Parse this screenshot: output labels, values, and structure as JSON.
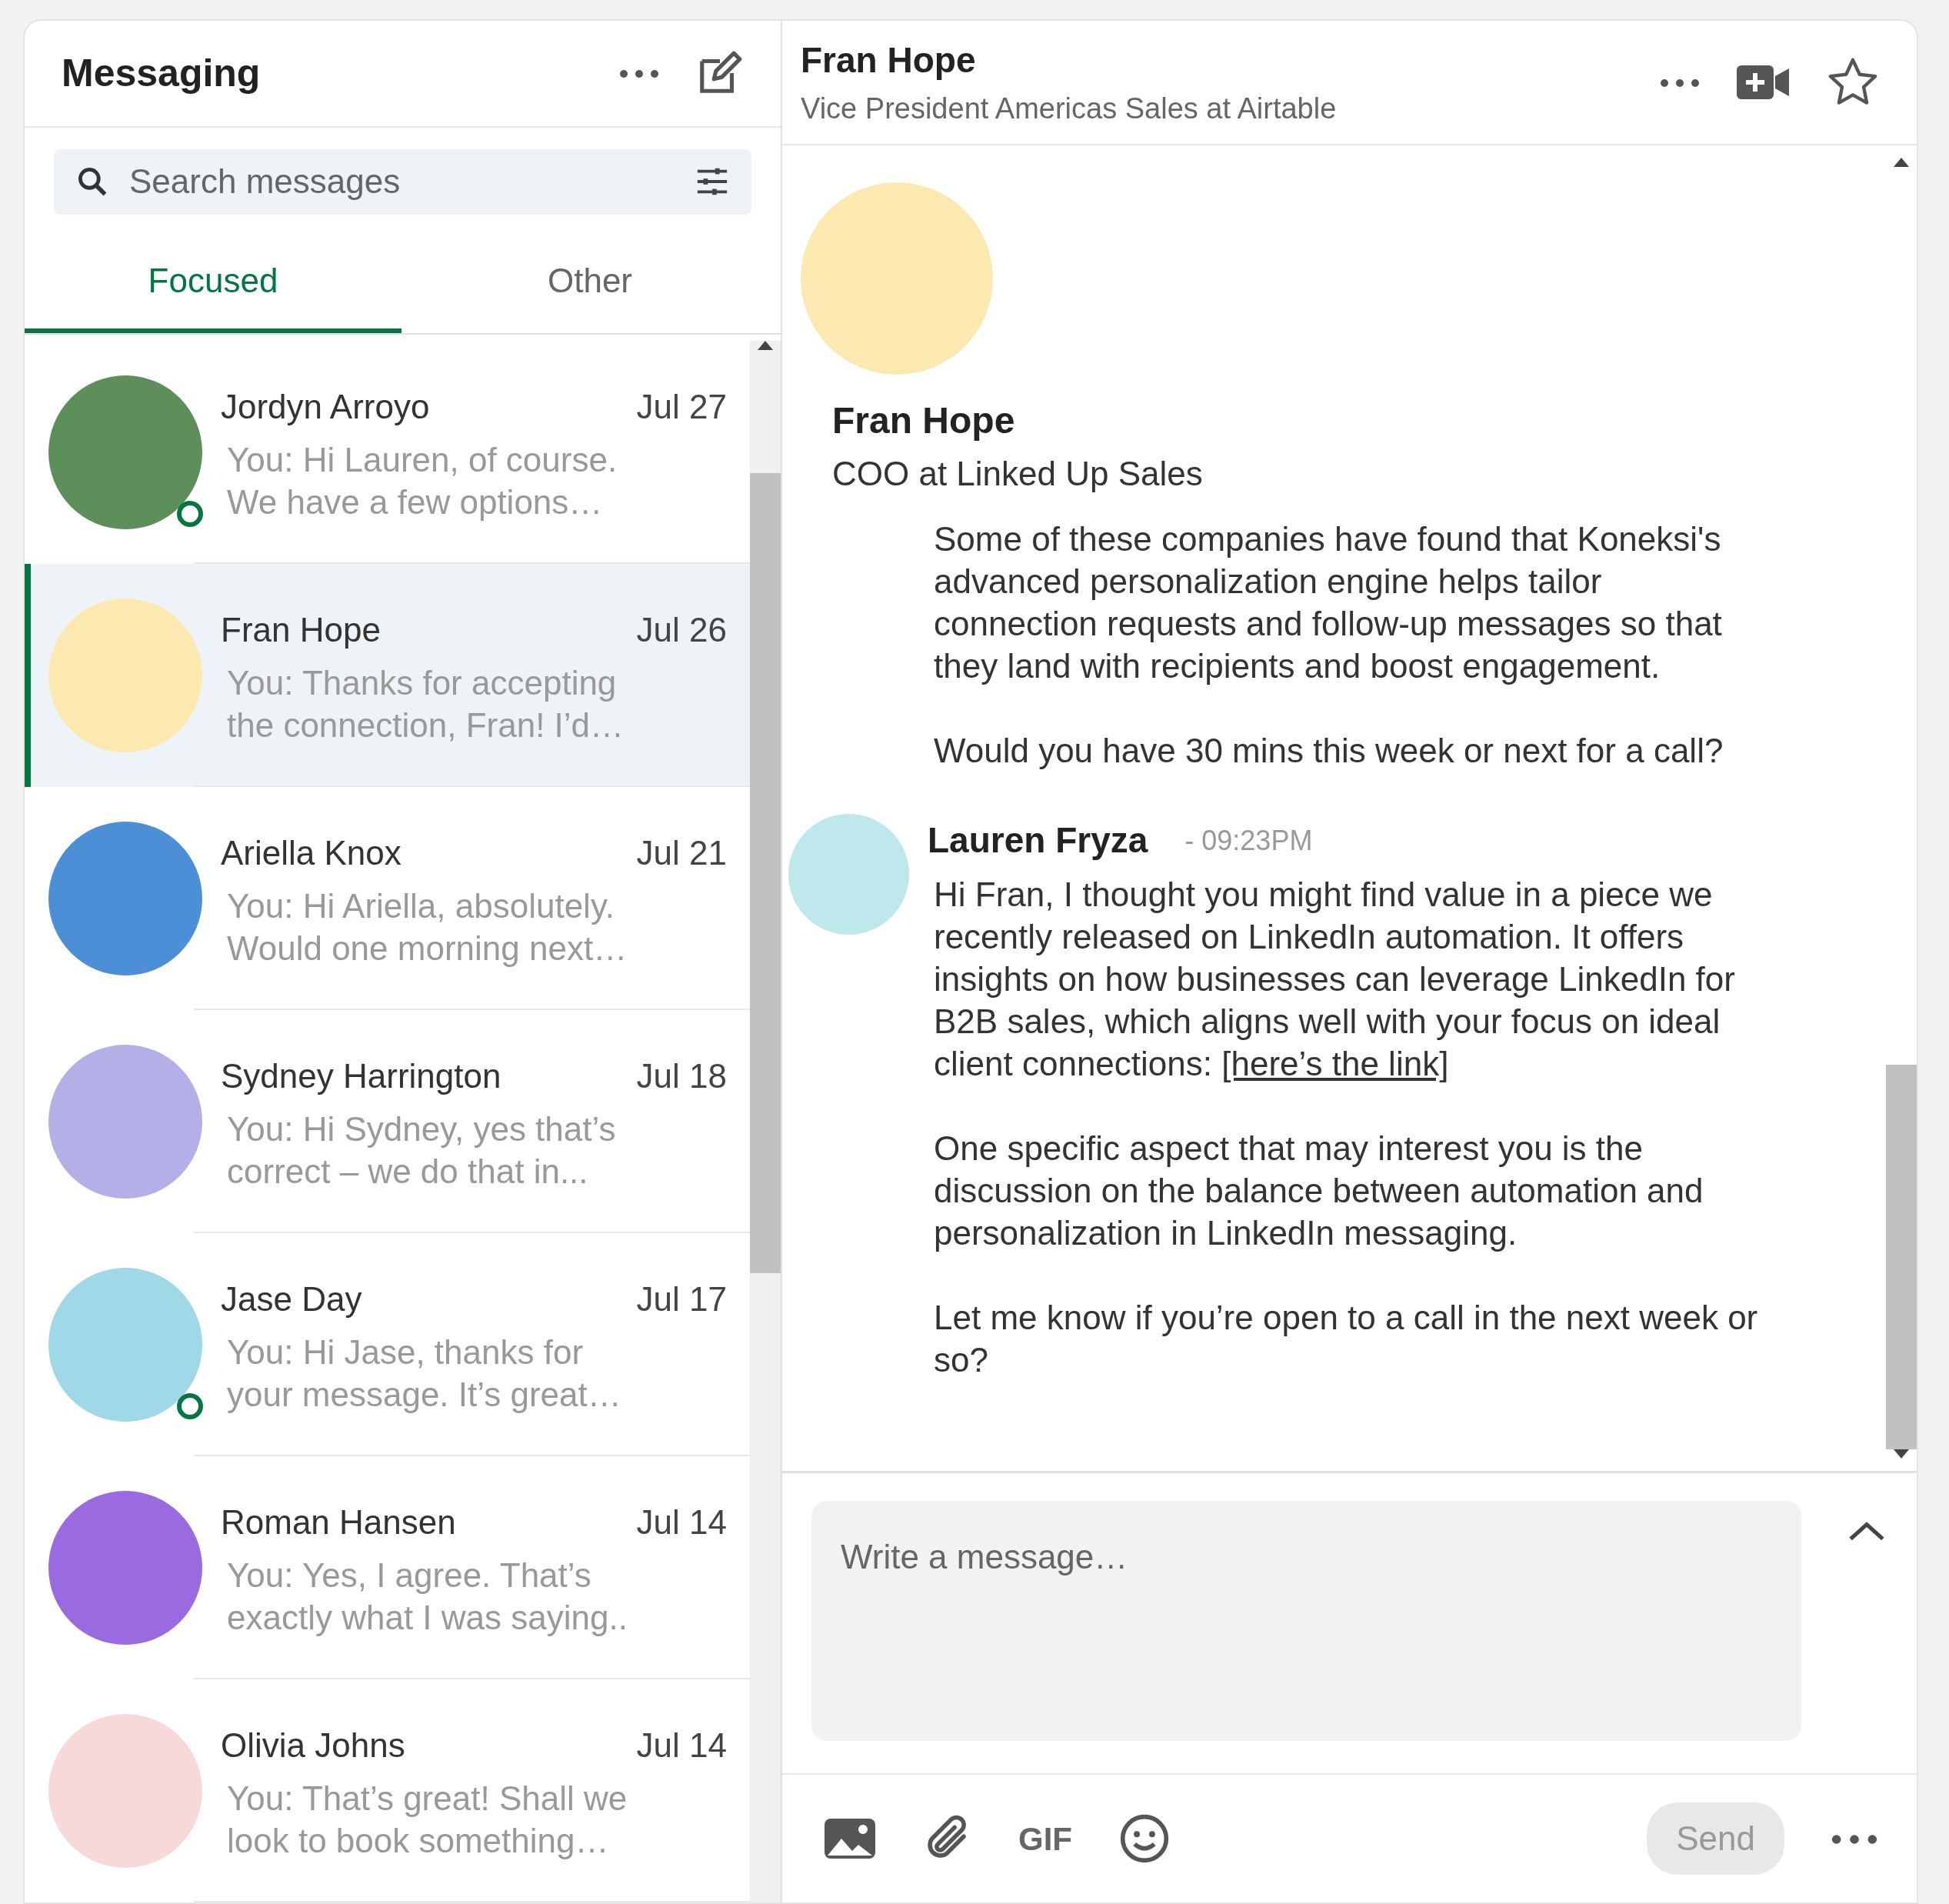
{
  "sidebar": {
    "title": "Messaging",
    "search": {
      "placeholder": "Search messages"
    },
    "tabs": [
      {
        "label": "Focused",
        "selected": true
      },
      {
        "label": "Other",
        "selected": false
      }
    ],
    "conversations": [
      {
        "name": "Jordyn Arroyo",
        "date": "Jul 27",
        "preview": "You: Hi Lauren, of course. We have a few options…",
        "selected": false,
        "online": true,
        "color": "#5e8f5a"
      },
      {
        "name": "Fran Hope",
        "date": "Jul 26",
        "preview": "You: Thanks for accepting the connection, Fran! I’d…",
        "selected": true,
        "online": false,
        "color": "#fbe9b0"
      },
      {
        "name": "Ariella Knox",
        "date": "Jul 21",
        "preview": "You: Hi Ariella, absolutely. Would one morning next…",
        "selected": false,
        "online": false,
        "color": "#4d8fd6"
      },
      {
        "name": "Sydney Harrington",
        "date": "Jul 18",
        "preview": "You: Hi Sydney, yes that’s correct – we do that in...",
        "selected": false,
        "online": false,
        "color": "#b3b0e8"
      },
      {
        "name": "Jase Day",
        "date": "Jul 17",
        "preview": "You: Hi Jase, thanks for your message. It’s great…",
        "selected": false,
        "online": true,
        "color": "#9fd8e6"
      },
      {
        "name": "Roman Hansen",
        "date": "Jul 14",
        "preview": "You: Yes, I agree. That’s exactly what I was saying..",
        "selected": false,
        "online": false,
        "color": "#9a6ae0"
      },
      {
        "name": "Olivia Johns",
        "date": "Jul 14",
        "preview": "You: That’s great! Shall we look to book something…",
        "selected": false,
        "online": false,
        "color": "#f7d9d9"
      }
    ]
  },
  "chat": {
    "header": {
      "name": "Fran Hope",
      "subtitle": "Vice President Americas Sales at Airtable"
    },
    "profile": {
      "name": "Fran Hope",
      "headline": "COO at Linked Up Sales"
    },
    "messages": [
      {
        "paragraphs": [
          {
            "text": "Some of these companies have found that Koneksi's advanced personalization engine helps tailor connection requests and follow-up messages so that they land with recipients and boost engagement."
          },
          {
            "text": "Would you have 30 mins this week or next for a call?"
          }
        ]
      },
      {
        "sender": "Lauren Fryza",
        "time": "- 09:23PM",
        "paragraphs": [
          {
            "text": "Hi Fran, I thought you might find value in a piece we recently released on LinkedIn automation. It offers insights on how businesses can leverage LinkedIn for B2B sales, which aligns well with your focus on ideal client connections: ",
            "link": "[here’s the link]"
          },
          {
            "text": "One specific aspect that may interest you is the discussion on the balance between automation and personalization in LinkedIn messaging."
          },
          {
            "text": "Let me know if you’re open to a call in the next week or so?"
          }
        ]
      }
    ],
    "composer": {
      "placeholder": "Write a message…",
      "gif": "GIF",
      "send": "Send"
    }
  }
}
